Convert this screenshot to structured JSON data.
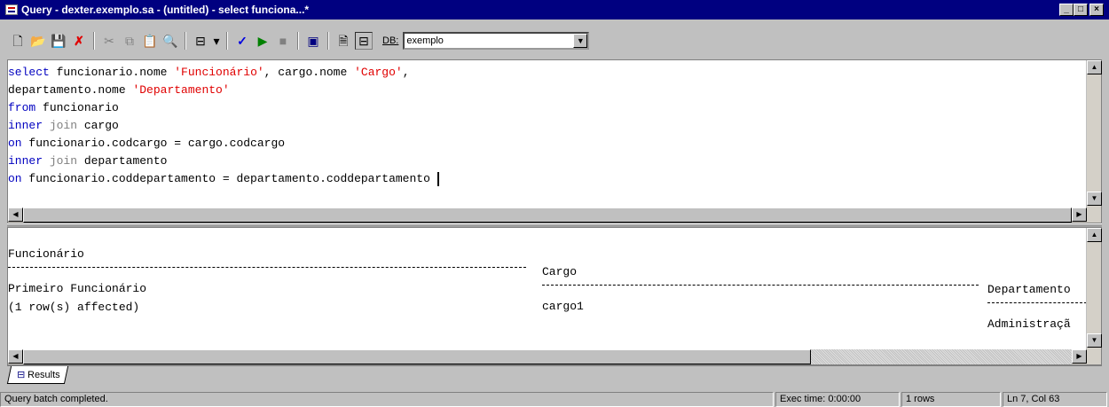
{
  "window": {
    "title": "Query - dexter.exemplo.sa - (untitled) - select funciona...*",
    "min_glyph": "_",
    "max_glyph": "□",
    "close_glyph": "×"
  },
  "toolbar": {
    "db_label": "DB:",
    "db_value": "exemplo",
    "dropdown_glyph": "▼",
    "tool_icons": {
      "new_query": "🗋",
      "open": "📂",
      "save": "💾",
      "delete": "✗",
      "cut": "✂",
      "copy": "⧉",
      "paste": "📋",
      "find": "🔍",
      "results_mode": "⊟",
      "dropdown": "▾",
      "parse": "✓",
      "execute": "▶",
      "stop": "■",
      "show_plan": "▣",
      "properties": "🗎",
      "results_pane": "⊟"
    }
  },
  "editor": {
    "lines": [
      [
        {
          "t": "select",
          "c": "kw"
        },
        {
          "t": " funcionario.nome "
        },
        {
          "t": "'Funcionário'",
          "c": "str"
        },
        {
          "t": ", cargo.nome "
        },
        {
          "t": "'Cargo'",
          "c": "str"
        },
        {
          "t": ","
        }
      ],
      [
        {
          "t": "departamento.nome "
        },
        {
          "t": "'Departamento'",
          "c": "str"
        }
      ],
      [
        {
          "t": "from",
          "c": "kw"
        },
        {
          "t": " funcionario"
        }
      ],
      [
        {
          "t": "inner",
          "c": "kw"
        },
        {
          "t": " join",
          "c": "gry"
        },
        {
          "t": " cargo"
        }
      ],
      [
        {
          "t": "on",
          "c": "kw"
        },
        {
          "t": " funcionario.codcargo = cargo.codcargo"
        }
      ],
      [
        {
          "t": "inner",
          "c": "kw"
        },
        {
          "t": " join",
          "c": "gry"
        },
        {
          "t": " departamento"
        }
      ],
      [
        {
          "t": "on",
          "c": "kw"
        },
        {
          "t": " funcionario.coddepartamento = departamento.coddepartamento "
        }
      ]
    ]
  },
  "results": {
    "columns": [
      "Funcionário",
      "Cargo",
      "Departamento"
    ],
    "rows": [
      [
        "Primeiro Funcionário",
        "cargo1",
        "Administraçã"
      ]
    ],
    "message": "(1 row(s) affected)"
  },
  "tabs": {
    "results_label": "Results"
  },
  "statusbar": {
    "message": "Query batch completed.",
    "exec_time": "Exec time: 0:00:00",
    "rows": "1 rows",
    "position": "Ln 7, Col 63"
  }
}
